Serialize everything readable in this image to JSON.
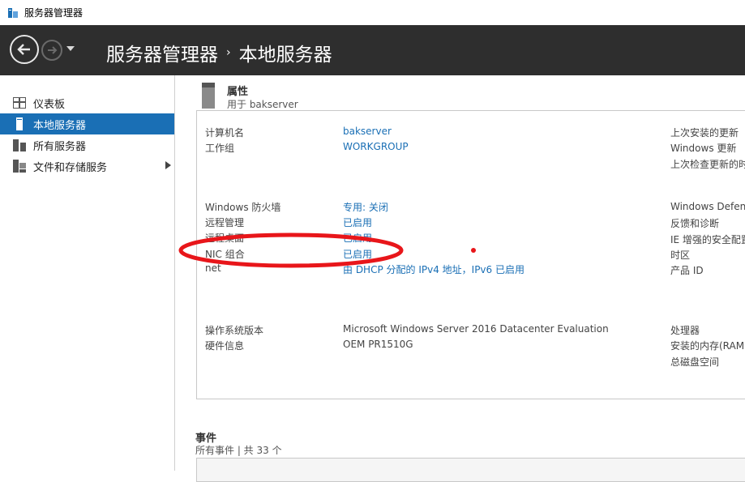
{
  "window": {
    "title": "服务器管理器"
  },
  "header": {
    "breadcrumb_root": "服务器管理器",
    "breadcrumb_separator": "›",
    "breadcrumb_current": "本地服务器"
  },
  "sidebar": {
    "items": [
      {
        "label": "仪表板",
        "icon": "dashboard-icon"
      },
      {
        "label": "本地服务器",
        "icon": "server-icon",
        "active": true
      },
      {
        "label": "所有服务器",
        "icon": "servers-icon"
      },
      {
        "label": "文件和存储服务",
        "icon": "storage-icon",
        "has_submenu": true
      }
    ]
  },
  "properties": {
    "title": "属性",
    "subtitle": "用于 bakserver",
    "col1": [
      {
        "label": "计算机名",
        "value": "bakserver",
        "link": true
      },
      {
        "label": "工作组",
        "value": "WORKGROUP",
        "link": true
      },
      {
        "label": "Windows 防火墙",
        "value": "专用: 关闭",
        "link": true
      },
      {
        "label": "远程管理",
        "value": "已启用",
        "link": true
      },
      {
        "label": "远程桌面",
        "value": "已启用",
        "link": true
      },
      {
        "label": "NIC 组合",
        "value": "已启用",
        "link": true
      },
      {
        "label": "net",
        "value": "由 DHCP 分配的 IPv4 地址，IPv6 已启用",
        "link": true
      },
      {
        "label": "操作系统版本",
        "value": "Microsoft Windows Server 2016 Datacenter Evaluation",
        "link": false
      },
      {
        "label": "硬件信息",
        "value": "OEM PR1510G",
        "link": false
      }
    ],
    "col2": [
      "上次安装的更新",
      "Windows 更新",
      "上次检查更新的时",
      "Windows Defend",
      "反馈和诊断",
      "IE 增强的安全配置",
      "时区",
      "产品 ID",
      "处理器",
      "安装的内存(RAM",
      "总磁盘空间"
    ]
  },
  "events": {
    "title": "事件",
    "subtitle": "所有事件 | 共 33 个"
  },
  "colors": {
    "header_bg": "#2e2e2e",
    "accent": "#1a6fb5",
    "annotation": "#e8161a"
  }
}
